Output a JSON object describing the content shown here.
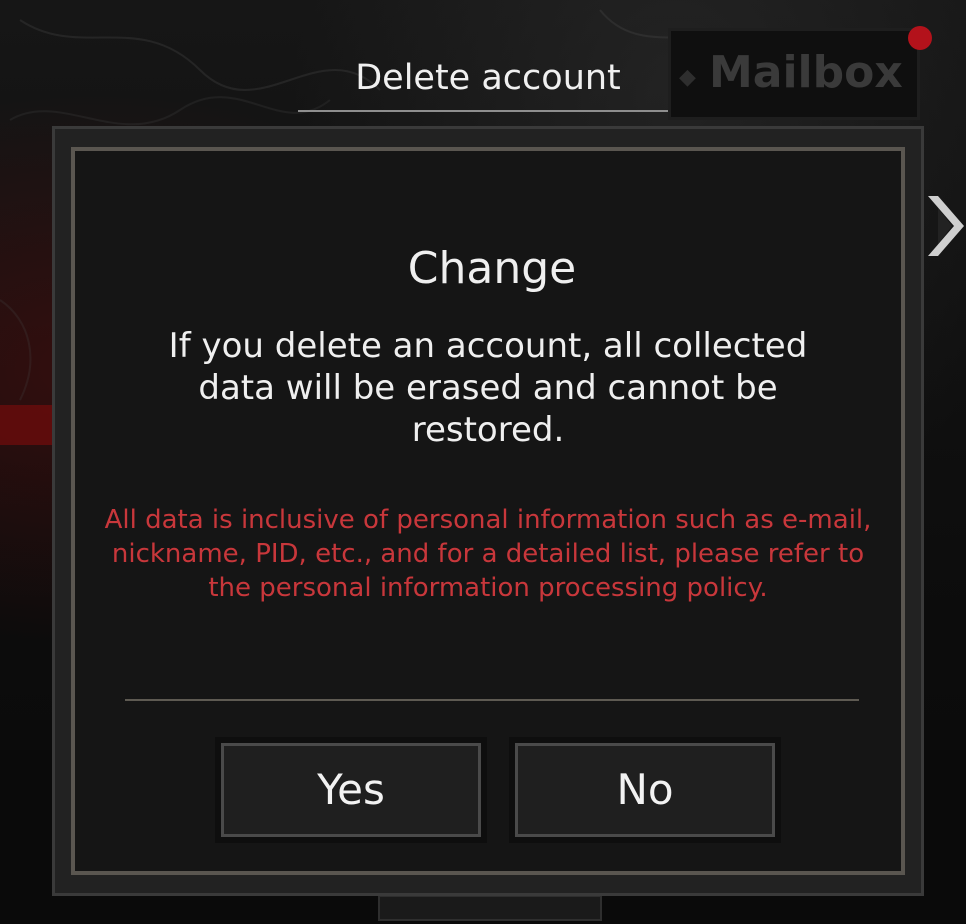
{
  "tabs": {
    "delete_account": "Delete account",
    "mailbox": "Mailbox"
  },
  "dialog": {
    "title": "Change",
    "message": "If you delete an account, all collected data will be erased and cannot be restored.",
    "warning": "All data is inclusive of personal information such as e-mail, nickname, PID, etc., and for a detailed list, please refer to the personal information processing policy.",
    "yes_label": "Yes",
    "no_label": "No"
  },
  "icons": {
    "notification": "notification-dot-icon",
    "side_arrow": "chevron-right-icon"
  },
  "colors": {
    "warning_text": "#c8373b",
    "notification_dot": "#b3121b",
    "dialog_background": "#151515",
    "text_primary": "#efefef"
  }
}
